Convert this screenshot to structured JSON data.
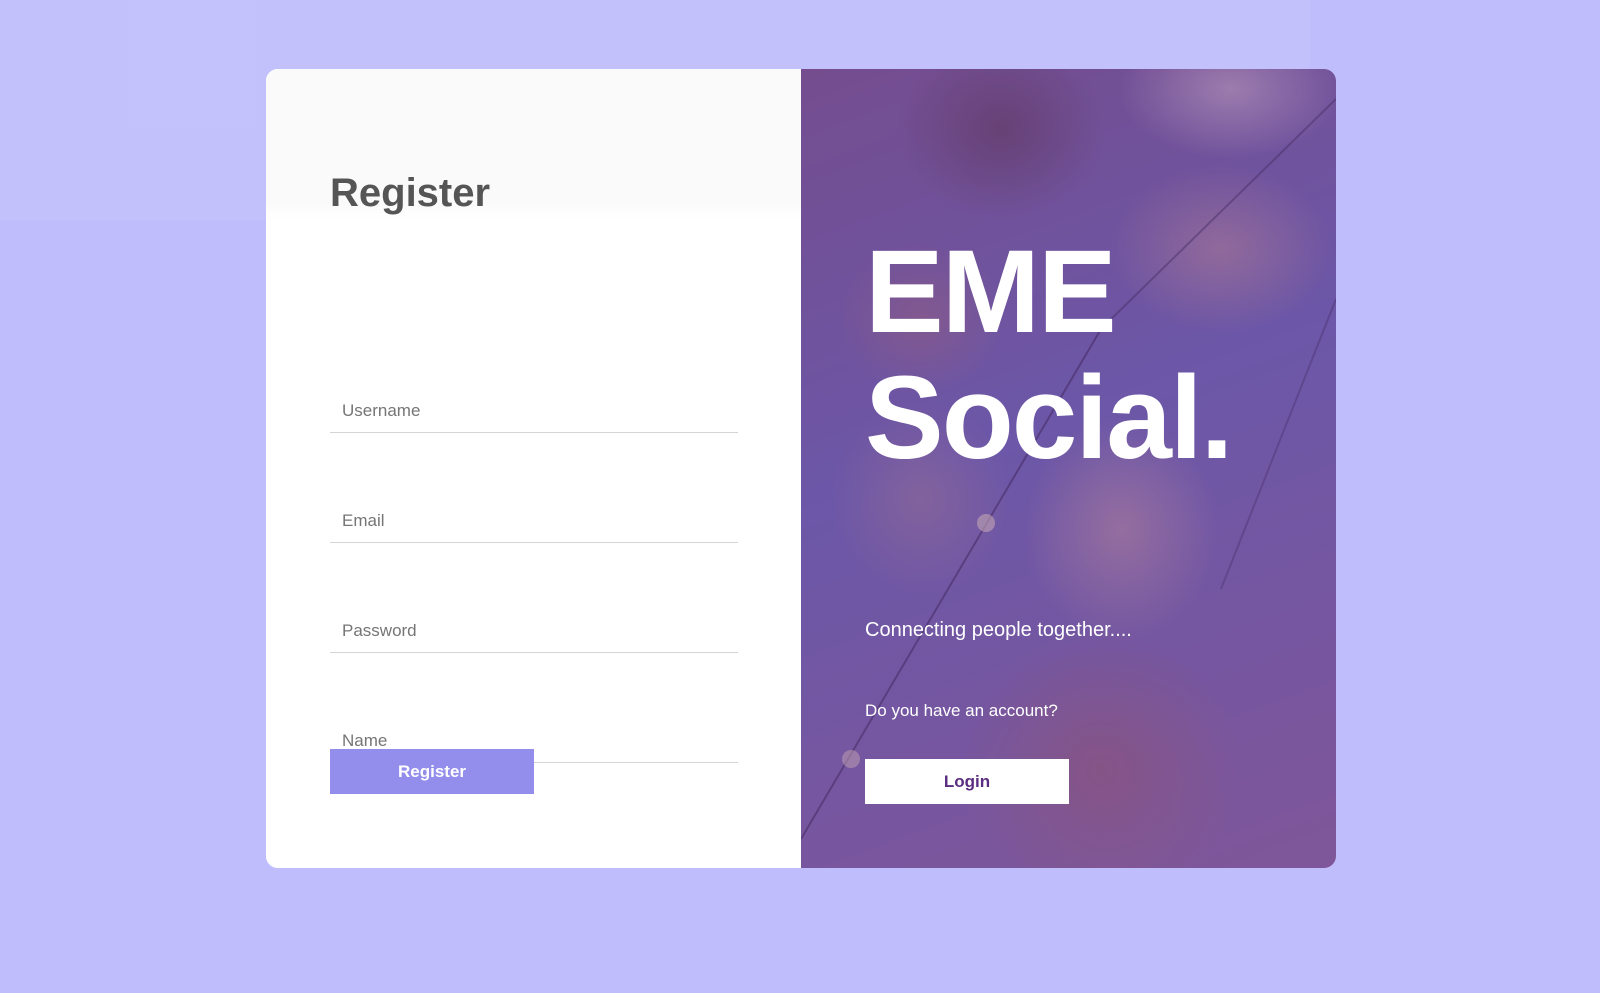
{
  "register_panel": {
    "title": "Register",
    "fields": {
      "username": {
        "placeholder": "Username",
        "value": ""
      },
      "email": {
        "placeholder": "Email",
        "value": ""
      },
      "password": {
        "placeholder": "Password",
        "value": ""
      },
      "name": {
        "placeholder": "Name",
        "value": ""
      }
    },
    "submit_label": "Register"
  },
  "brand_panel": {
    "brand_line1": "EME",
    "brand_line2": "Social.",
    "tagline": "Connecting people together....",
    "account_question": "Do you have an account?",
    "login_label": "Login"
  },
  "colors": {
    "page_background": "#bfbdfc",
    "register_button": "#938eeb",
    "brand_overlay": "#6e3c96",
    "login_text": "#5a2d80"
  }
}
